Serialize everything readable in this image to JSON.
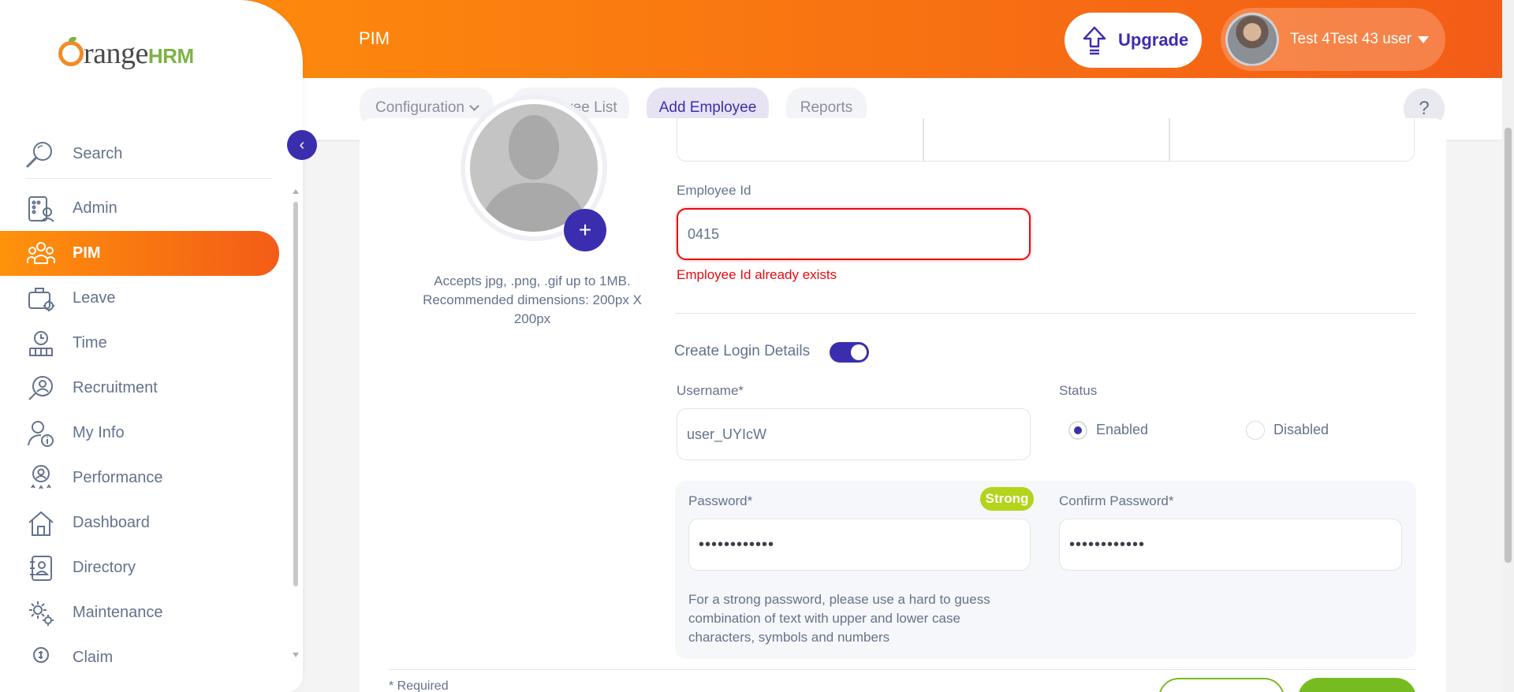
{
  "brand": {
    "logo_text": "range",
    "logo_suffix": "HRM",
    "accent": "#ff7b1d",
    "primary": "#3b2eae",
    "error": "#eb0910",
    "success": "#76bc21"
  },
  "header": {
    "title": "PIM",
    "upgrade_label": "Upgrade",
    "user_name": "Test 4Test 43 user"
  },
  "subnav": {
    "configuration": "Configuration",
    "employee_list": "Employee List",
    "add_employee": "Add Employee",
    "reports": "Reports",
    "help": "?"
  },
  "sidebar": {
    "search_label": "Search",
    "items": [
      {
        "label": "Admin",
        "icon": "admin-icon"
      },
      {
        "label": "PIM",
        "icon": "pim-icon",
        "active": true
      },
      {
        "label": "Leave",
        "icon": "leave-icon"
      },
      {
        "label": "Time",
        "icon": "time-icon"
      },
      {
        "label": "Recruitment",
        "icon": "recruitment-icon"
      },
      {
        "label": "My Info",
        "icon": "my-info-icon"
      },
      {
        "label": "Performance",
        "icon": "performance-icon"
      },
      {
        "label": "Dashboard",
        "icon": "dashboard-icon"
      },
      {
        "label": "Directory",
        "icon": "directory-icon"
      },
      {
        "label": "Maintenance",
        "icon": "maintenance-icon"
      },
      {
        "label": "Claim",
        "icon": "claim-icon"
      }
    ]
  },
  "photo": {
    "hint": "Accepts jpg, .png, .gif up to 1MB. Recommended dimensions: 200px X 200px",
    "add_label": "+"
  },
  "form": {
    "employee_id_label": "Employee Id",
    "employee_id_value": "0415",
    "employee_id_error": "Employee Id already exists",
    "create_login_label": "Create Login Details",
    "create_login_on": true,
    "username_label": "Username*",
    "username_value": "user_UYIcW",
    "status_label": "Status",
    "status_enabled": "Enabled",
    "status_disabled": "Disabled",
    "status_selected": "Enabled",
    "password_label": "Password*",
    "password_value": "••••••••••••",
    "password_strength": "Strong",
    "confirm_password_label": "Confirm Password*",
    "confirm_password_value": "••••••••••••",
    "password_hint": "For a strong password, please use a hard to guess combination of text with upper and lower case characters, symbols and numbers",
    "required_note": "* Required"
  }
}
